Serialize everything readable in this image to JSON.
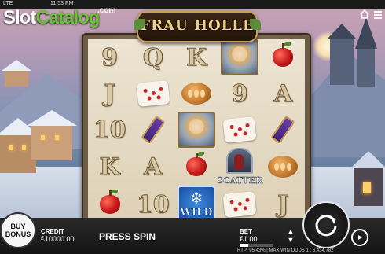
{
  "topbar": {
    "left_text": "LTE",
    "time": "11:53 PM"
  },
  "watermark": {
    "slot": "Slot",
    "catalog": "Catalog",
    "com": ".com"
  },
  "game": {
    "title": "FRAU HOLLE"
  },
  "reels": [
    [
      {
        "type": "letter",
        "text": "9"
      },
      {
        "type": "letter",
        "text": "J"
      },
      {
        "type": "letter",
        "text": "10"
      },
      {
        "type": "letter",
        "text": "K"
      },
      {
        "type": "apple"
      }
    ],
    [
      {
        "type": "letter",
        "text": "Q"
      },
      {
        "type": "pillow"
      },
      {
        "type": "spindle"
      },
      {
        "type": "letter",
        "text": "A"
      },
      {
        "type": "letter",
        "text": "10"
      }
    ],
    [
      {
        "type": "letter",
        "text": "K"
      },
      {
        "type": "bread"
      },
      {
        "type": "portrait"
      },
      {
        "type": "apple"
      },
      {
        "type": "wild",
        "text": "WILD"
      }
    ],
    [
      {
        "type": "portrait"
      },
      {
        "type": "letter",
        "text": "9"
      },
      {
        "type": "pillow"
      },
      {
        "type": "scatter",
        "text": "SCATTER"
      },
      {
        "type": "pillow"
      }
    ],
    [
      {
        "type": "apple"
      },
      {
        "type": "letter",
        "text": "A"
      },
      {
        "type": "spindle"
      },
      {
        "type": "bread"
      },
      {
        "type": "letter",
        "text": "J"
      }
    ]
  ],
  "buy_bonus": {
    "line1": "BUY",
    "line2": "BONUS"
  },
  "credit": {
    "label": "CREDIT",
    "value": "€10000.00"
  },
  "press_spin": "PRESS SPIN",
  "bet": {
    "label": "BET",
    "value": "€1.00",
    "level": 0.25
  },
  "rtp_text": "RTP: 95.43% | MAX WIN ODDS 1 : 6,434,782",
  "colors": {
    "accent_green": "#6fbf3a",
    "title_gold": "#f1d28a",
    "bar_bg": "#141414"
  }
}
